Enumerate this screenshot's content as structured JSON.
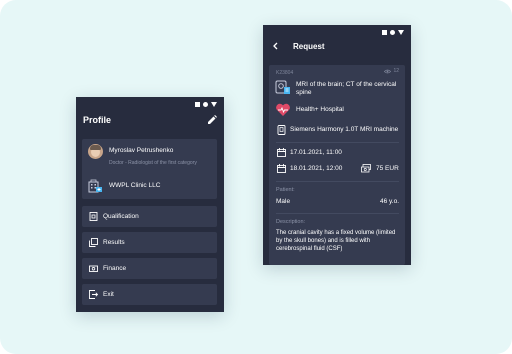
{
  "colors": {
    "background": "#e6f7f7",
    "panel": "#272c3e",
    "card": "#353b50",
    "text": "#ffffff",
    "muted": "#8c93a8",
    "accent_clinic": "#49b5f0",
    "accent_heart": "#e04a68"
  },
  "profile": {
    "title": "Profile",
    "user_name": "Myroslav Petrushenko",
    "user_role": "Doctor - Radiologist of the first category",
    "clinic": "WWPL Clinic LLC",
    "menu": [
      {
        "label": "Qualification",
        "icon": "qualification-icon"
      },
      {
        "label": "Results",
        "icon": "results-icon"
      },
      {
        "label": "Finance",
        "icon": "finance-icon"
      },
      {
        "label": "Exit",
        "icon": "exit-icon"
      }
    ]
  },
  "request": {
    "title": "Request",
    "id": "K23804",
    "views": "12",
    "exam": "MRI of the brain; CT of the cervical spine",
    "hospital": "Health+ Hospital",
    "machine": "Siemens Harmony 1.0T MRI machine",
    "start_datetime": "17.01.2021, 11:00",
    "end_datetime": "18.01.2021, 12:00",
    "price": "75 EUR",
    "patient_label": "Patient:",
    "patient_gender": "Male",
    "patient_age": "46 y.o.",
    "description_label": "Description:",
    "description": "The cranial cavity has a fixed volume (limited by the skull bones) and is filled with cerebrospinal fluid (CSF)"
  }
}
